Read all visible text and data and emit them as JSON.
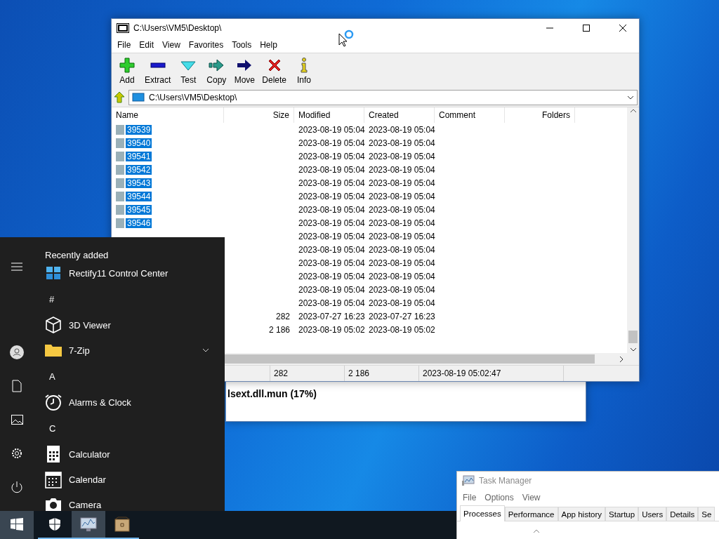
{
  "archive_window": {
    "title": "C:\\Users\\VM5\\Desktop\\",
    "menu": [
      "File",
      "Edit",
      "View",
      "Favorites",
      "Tools",
      "Help"
    ],
    "toolbar": [
      {
        "kind": "add",
        "label": "Add"
      },
      {
        "kind": "extract",
        "label": "Extract"
      },
      {
        "kind": "test",
        "label": "Test"
      },
      {
        "kind": "copy",
        "label": "Copy"
      },
      {
        "kind": "move",
        "label": "Move"
      },
      {
        "kind": "delete",
        "label": "Delete"
      },
      {
        "kind": "info",
        "label": "Info"
      }
    ],
    "address": "C:\\Users\\VM5\\Desktop\\",
    "columns": [
      "Name",
      "Size",
      "Modified",
      "Created",
      "Comment",
      "Folders"
    ],
    "rows": [
      {
        "name": "39539",
        "selected": true,
        "modified": "2023-08-19 05:04",
        "created": "2023-08-19 05:04"
      },
      {
        "name": "39540",
        "selected": true,
        "modified": "2023-08-19 05:04",
        "created": "2023-08-19 05:04"
      },
      {
        "name": "39541",
        "selected": true,
        "modified": "2023-08-19 05:04",
        "created": "2023-08-19 05:04"
      },
      {
        "name": "39542",
        "selected": true,
        "modified": "2023-08-19 05:04",
        "created": "2023-08-19 05:04"
      },
      {
        "name": "39543",
        "selected": true,
        "modified": "2023-08-19 05:04",
        "created": "2023-08-19 05:04"
      },
      {
        "name": "39544",
        "selected": true,
        "modified": "2023-08-19 05:04",
        "created": "2023-08-19 05:04"
      },
      {
        "name": "39545",
        "selected": true,
        "modified": "2023-08-19 05:04",
        "created": "2023-08-19 05:04"
      },
      {
        "name": "39546",
        "selected": true,
        "modified": "2023-08-19 05:04",
        "created": "2023-08-19 05:04"
      },
      {
        "modified": "2023-08-19 05:04",
        "created": "2023-08-19 05:04"
      },
      {
        "modified": "2023-08-19 05:04",
        "created": "2023-08-19 05:04"
      },
      {
        "modified": "2023-08-19 05:04",
        "created": "2023-08-19 05:04"
      },
      {
        "modified": "2023-08-19 05:04",
        "created": "2023-08-19 05:04"
      },
      {
        "modified": "2023-08-19 05:04",
        "created": "2023-08-19 05:04"
      },
      {
        "modified": "2023-08-19 05:04",
        "created": "2023-08-19 05:04"
      },
      {
        "size": "282",
        "modified": "2023-07-27 16:23",
        "created": "2023-07-27 16:23"
      },
      {
        "size": "2 186",
        "modified": "2023-08-19 05:02",
        "created": "2023-08-19 05:02"
      }
    ],
    "status_bar": [
      "282",
      "2 186",
      "2023-08-19 05:02:47"
    ]
  },
  "progress_dialog": {
    "text": "lsext.dll.mun (17%)"
  },
  "start_menu": {
    "header": "Recently added",
    "items": [
      {
        "kind": "app",
        "label": "Rectify11 Control Center"
      },
      {
        "kind": "letter",
        "label": "#"
      },
      {
        "kind": "app",
        "label": "3D Viewer"
      },
      {
        "kind": "folder",
        "label": "7-Zip",
        "expanded": false
      },
      {
        "kind": "letter",
        "label": "A"
      },
      {
        "kind": "app",
        "label": "Alarms & Clock"
      },
      {
        "kind": "letter",
        "label": "C"
      },
      {
        "kind": "app",
        "label": "Calculator"
      },
      {
        "kind": "app",
        "label": "Calendar"
      },
      {
        "kind": "app",
        "label": "Camera"
      }
    ]
  },
  "task_manager": {
    "title": "Task Manager",
    "menu": [
      "File",
      "Options",
      "View"
    ],
    "tabs": [
      {
        "label": "Processes",
        "selected": true
      },
      {
        "label": "Performance",
        "selected": false
      },
      {
        "label": "App history",
        "selected": false
      },
      {
        "label": "Startup",
        "selected": false
      },
      {
        "label": "Users",
        "selected": false
      },
      {
        "label": "Details",
        "selected": false
      },
      {
        "label": "Se",
        "selected": false
      }
    ]
  }
}
